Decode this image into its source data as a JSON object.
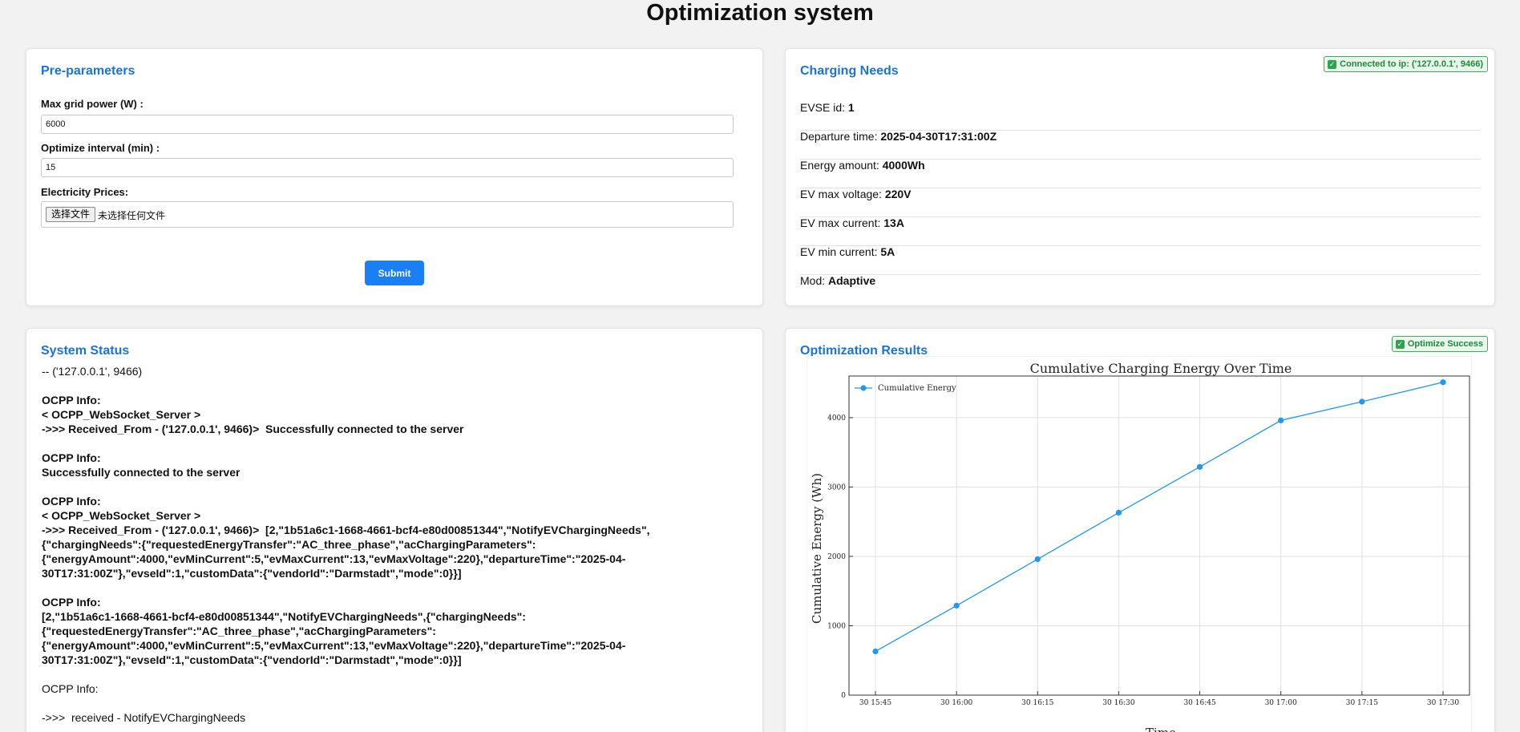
{
  "page": {
    "title": "Optimization system"
  },
  "pre_parameters": {
    "title": "Pre-parameters",
    "max_grid_power_label": "Max grid power (W) :",
    "max_grid_power_value": "6000",
    "optimize_interval_label": "Optimize interval (min) :",
    "optimize_interval_value": "15",
    "electricity_prices_label": "Electricity Prices:",
    "file_button_label": "选择文件",
    "file_status": "未选择任何文件",
    "submit_label": "Submit"
  },
  "charging_needs": {
    "title": "Charging Needs",
    "connection_badge": "Connected to ip: ('127.0.0.1', 9466)",
    "rows": [
      {
        "label": "EVSE id: ",
        "value": "1"
      },
      {
        "label": "Departure time: ",
        "value": "2025-04-30T17:31:00Z"
      },
      {
        "label": "Energy amount: ",
        "value": "4000Wh"
      },
      {
        "label": "EV max voltage: ",
        "value": "220V"
      },
      {
        "label": "EV max current: ",
        "value": "13A"
      },
      {
        "label": "EV min current: ",
        "value": "5A"
      },
      {
        "label": "Mod: ",
        "value": "Adaptive"
      }
    ]
  },
  "system_status": {
    "title": "System Status",
    "log": [
      {
        "text": "-- ('127.0.0.1', 9466)",
        "bold": false
      },
      {
        "text": "",
        "bold": false
      },
      {
        "text": "OCPP Info:",
        "bold": true
      },
      {
        "text": "< OCPP_WebSocket_Server >",
        "bold": true
      },
      {
        "text": "->>> Received_From - ('127.0.0.1', 9466)>  Successfully connected to the server",
        "bold": true
      },
      {
        "text": "",
        "bold": false
      },
      {
        "text": "OCPP Info:",
        "bold": true
      },
      {
        "text": "Successfully connected to the server",
        "bold": true
      },
      {
        "text": "",
        "bold": false
      },
      {
        "text": "OCPP Info:",
        "bold": true
      },
      {
        "text": "< OCPP_WebSocket_Server >",
        "bold": true
      },
      {
        "text": "->>> Received_From - ('127.0.0.1', 9466)>  [2,\"1b51a6c1-1668-4661-bcf4-e80d00851344\",\"NotifyEVChargingNeeds\",",
        "bold": true
      },
      {
        "text": "{\"chargingNeeds\":{\"requestedEnergyTransfer\":\"AC_three_phase\",\"acChargingParameters\":",
        "bold": true
      },
      {
        "text": "{\"energyAmount\":4000,\"evMinCurrent\":5,\"evMaxCurrent\":13,\"evMaxVoltage\":220},\"departureTime\":\"2025-04-",
        "bold": true
      },
      {
        "text": "30T17:31:00Z\"},\"evseId\":1,\"customData\":{\"vendorId\":\"Darmstadt\",\"mode\":0}}]",
        "bold": true
      },
      {
        "text": "",
        "bold": false
      },
      {
        "text": "OCPP Info:",
        "bold": true
      },
      {
        "text": "[2,\"1b51a6c1-1668-4661-bcf4-e80d00851344\",\"NotifyEVChargingNeeds\",{\"chargingNeeds\":",
        "bold": true
      },
      {
        "text": "{\"requestedEnergyTransfer\":\"AC_three_phase\",\"acChargingParameters\":",
        "bold": true
      },
      {
        "text": "{\"energyAmount\":4000,\"evMinCurrent\":5,\"evMaxCurrent\":13,\"evMaxVoltage\":220},\"departureTime\":\"2025-04-",
        "bold": true
      },
      {
        "text": "30T17:31:00Z\"},\"evseId\":1,\"customData\":{\"vendorId\":\"Darmstadt\",\"mode\":0}}]",
        "bold": true
      },
      {
        "text": "",
        "bold": false
      },
      {
        "text": "OCPP Info:",
        "bold": false
      },
      {
        "text": "",
        "bold": false
      },
      {
        "text": "->>>  received - NotifyEVChargingNeeds",
        "bold": false
      }
    ]
  },
  "optimization_results": {
    "title": "Optimization Results",
    "success_badge": "Optimize Success"
  },
  "colors": {
    "accent": "#1a73d9",
    "submit": "#1a7ef5",
    "success": "#2ea44f",
    "series": "#2196f3"
  },
  "chart_data": {
    "type": "line",
    "title": "Cumulative Charging Energy Over Time",
    "xlabel": "Time",
    "ylabel": "Cumulative Energy (Wh)",
    "x": [
      "30 15:45",
      "30 16:00",
      "30 16:15",
      "30 16:30",
      "30 16:45",
      "30 17:00",
      "30 17:15",
      "30 17:30"
    ],
    "series": [
      {
        "name": "Cumulative Energy",
        "values": [
          630,
          1290,
          1960,
          2630,
          3290,
          3960,
          4230,
          4510
        ]
      }
    ],
    "yticks": [
      0,
      1000,
      2000,
      3000,
      4000
    ],
    "ylim": [
      0,
      4600
    ],
    "grid": true,
    "legend": "top-left"
  }
}
